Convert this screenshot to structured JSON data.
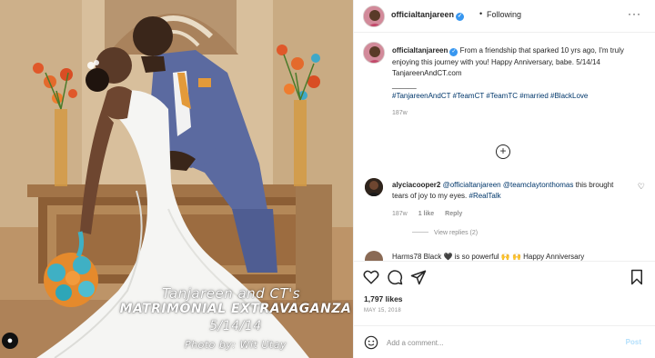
{
  "photo": {
    "caption_line1": "Tanjareen and CT's",
    "caption_line2": "MATRIMONIAL EXTRAVAGANZA",
    "caption_line3": "5/14/14",
    "caption_line4": "Photo by: Wit Utay"
  },
  "header": {
    "username": "officialtanjareen",
    "separator": "•",
    "follow_status": "Following",
    "more_icon": "more-horizontal-icon"
  },
  "caption": {
    "username": "officialtanjareen",
    "text": "From a friendship that sparked 10 yrs ago, I'm truly enjoying this journey with you! Happy Anniversary, babe. 5/14/14",
    "link": "TanjareenAndCT.com",
    "divider": "______",
    "hashtags": "#TanjareenAndCT #TeamCT #TeamTC #married #BlackLove",
    "time": "187w"
  },
  "load_more_icon": "plus-circle-icon",
  "comment": {
    "username": "alyciacooper2",
    "mention1": "@officialtanjareen",
    "mention2": "@teamclaytonthomas",
    "text_mid": "this brought tears of joy to my eyes.",
    "hashtag": "#RealTalk",
    "time": "187w",
    "likes": "1 like",
    "reply": "Reply",
    "view_replies": "View replies (2)"
  },
  "peek_comment": {
    "text": "Harms78 Black 🖤 is so powerful 🙌 🙌   Happy Anniversary"
  },
  "actions": {
    "likes": "1,797 likes",
    "date": "MAY 15, 2018"
  },
  "add_comment": {
    "placeholder": "Add a comment...",
    "post_label": "Post"
  },
  "colors": {
    "link": "#00376b",
    "verified": "#3897f0",
    "post_disabled": "#b2dffc",
    "meta_gray": "#8e8e8e",
    "suit": "#5b6aa0"
  }
}
